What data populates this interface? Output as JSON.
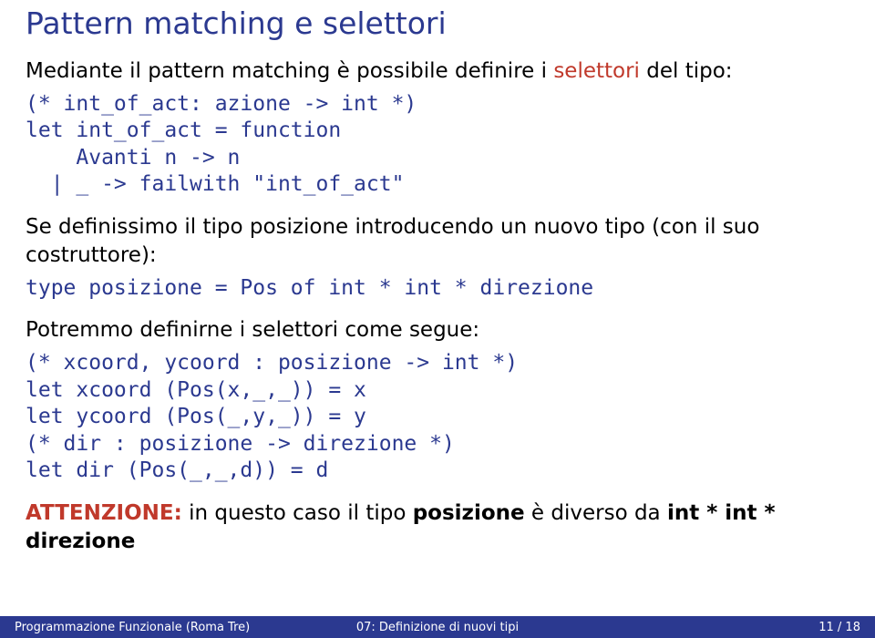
{
  "title": "Pattern matching e selettori",
  "para1_a": "Mediante il pattern matching è possibile definire i ",
  "para1_hl": "selettori",
  "para1_b": " del tipo:",
  "code1": "(* int_of_act: azione -> int *)\nlet int_of_act = function\n    Avanti n -> n\n  | _ -> failwith \"int_of_act\"",
  "para2": "Se definissimo il tipo posizione introducendo un nuovo tipo (con il suo costruttore):",
  "code2": "type posizione = Pos of int * int * direzione",
  "para3": "Potremmo definirne i selettori come segue:",
  "code3": "(* xcoord, ycoord : posizione -> int *)\nlet xcoord (Pos(x,_,_)) = x\nlet ycoord (Pos(_,y,_)) = y\n(* dir : posizione -> direzione *)\nlet dir (Pos(_,_,d)) = d",
  "attn_label": "ATTENZIONE:",
  "attn_a": " in questo caso il tipo ",
  "attn_b1": "posizione",
  "attn_mid": " è diverso da ",
  "attn_b2": "int * int * direzione",
  "footer": {
    "left": "Programmazione Funzionale (Roma Tre)",
    "center": "07: Definizione di nuovi tipi",
    "right": "11 / 18"
  }
}
